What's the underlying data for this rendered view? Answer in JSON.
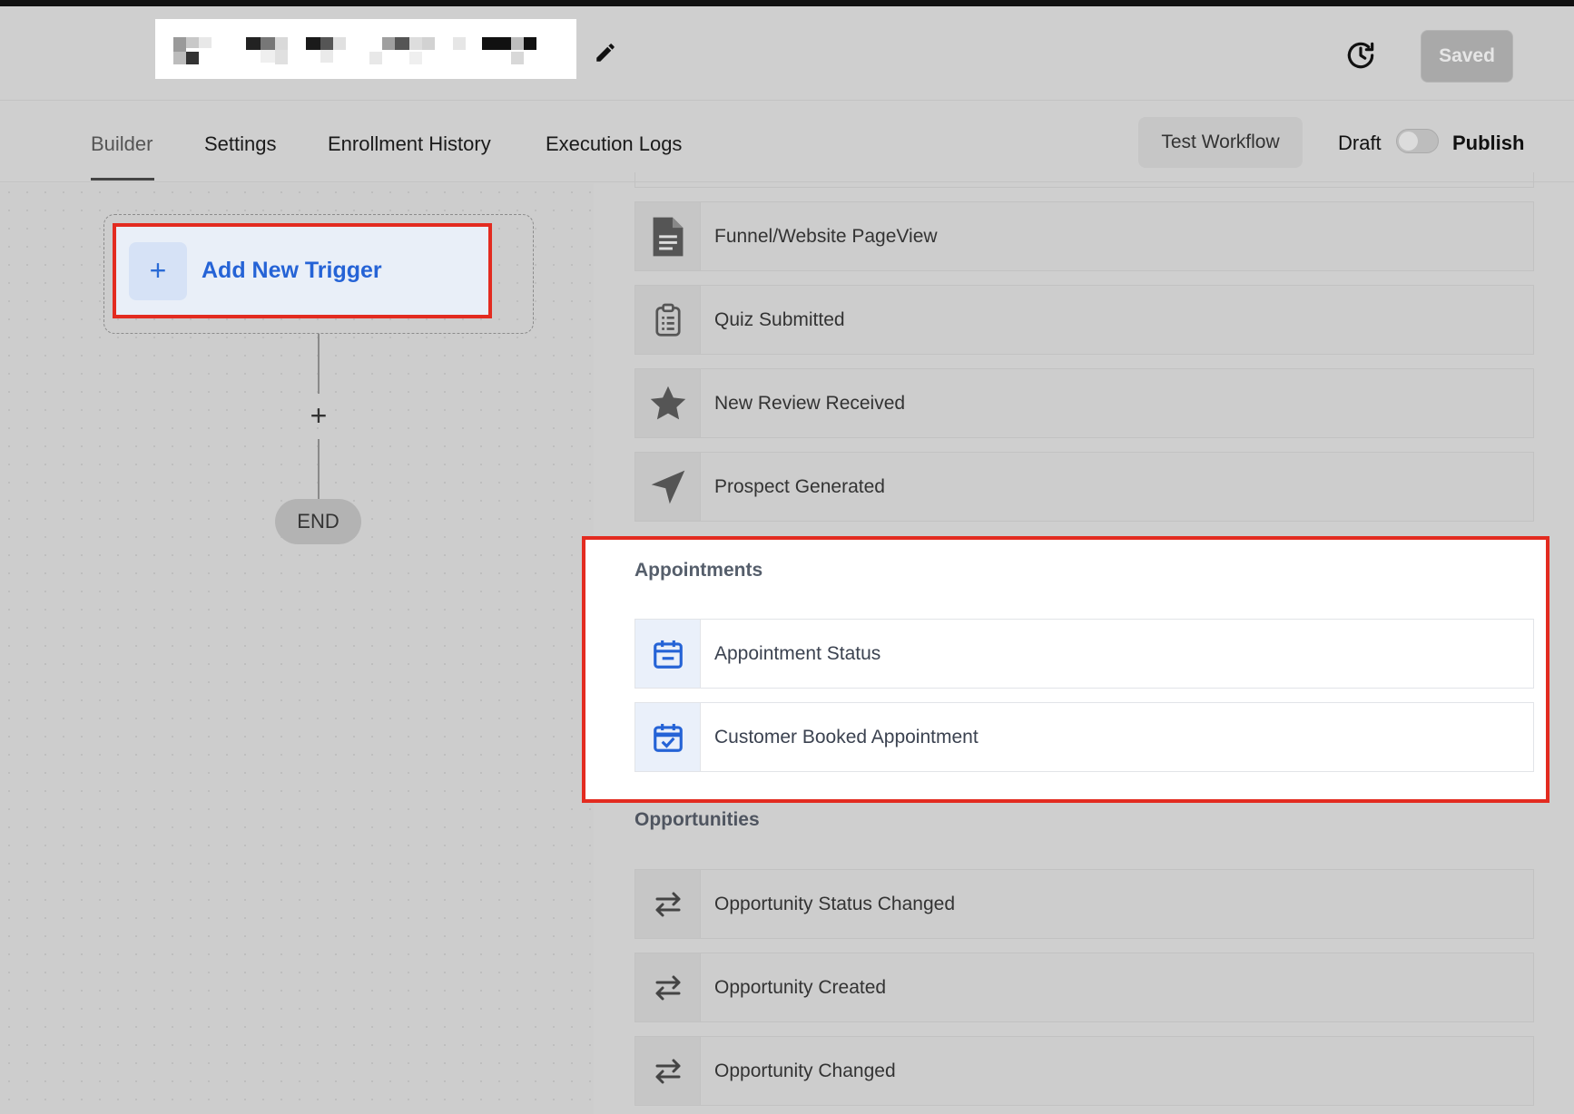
{
  "header": {
    "workflow_name": "",
    "saved_label": "Saved"
  },
  "tabs": [
    {
      "label": "Builder"
    },
    {
      "label": "Settings"
    },
    {
      "label": "Enrollment History"
    },
    {
      "label": "Execution Logs"
    }
  ],
  "toolbar": {
    "test_workflow_label": "Test Workflow",
    "draft_label": "Draft",
    "publish_label": "Publish",
    "publish_state": "off"
  },
  "builder": {
    "add_trigger_label": "Add New Trigger",
    "end_label": "END"
  },
  "trigger_list": {
    "items_top": [
      {
        "label": "Funnel/Website PageView",
        "icon": "document-icon"
      },
      {
        "label": "Quiz Submitted",
        "icon": "clipboard-icon"
      },
      {
        "label": "New Review Received",
        "icon": "star-icon"
      },
      {
        "label": "Prospect Generated",
        "icon": "navigation-arrow-icon"
      }
    ],
    "appointments": {
      "title": "Appointments",
      "items": [
        {
          "label": "Appointment Status",
          "icon": "calendar-icon"
        },
        {
          "label": "Customer Booked Appointment",
          "icon": "calendar-check-icon"
        }
      ]
    },
    "opportunities": {
      "title": "Opportunities",
      "items": [
        {
          "label": "Opportunity Status Changed",
          "icon": "swap-arrows-icon"
        },
        {
          "label": "Opportunity Created",
          "icon": "swap-arrows-icon"
        },
        {
          "label": "Opportunity Changed",
          "icon": "swap-arrows-icon"
        }
      ]
    }
  },
  "colors": {
    "highlight": "#e32b20",
    "accent_blue": "#2563d6"
  }
}
